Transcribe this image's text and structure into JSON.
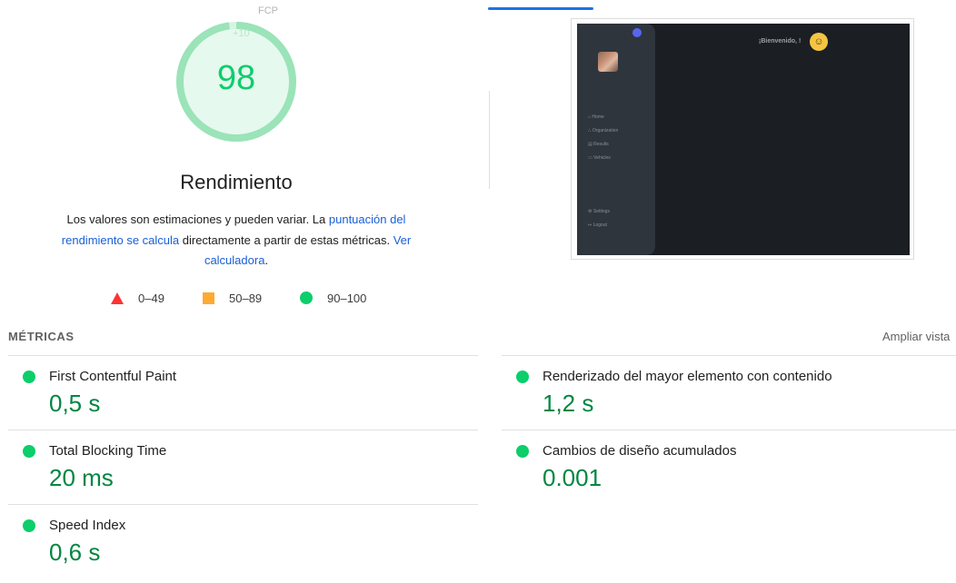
{
  "gauge": {
    "score": "98",
    "fraction": 0.98,
    "fcp_tag": "FCP",
    "fcp_value": "+10",
    "color": "#0cce6b"
  },
  "category_title": "Rendimiento",
  "description": {
    "text_1": "Los valores son estimaciones y pueden variar. La ",
    "link_1": "puntuación del rendimiento se calcula",
    "text_2": " directamente a partir de estas métricas. ",
    "link_2": "Ver calculadora",
    "text_3": "."
  },
  "legend": {
    "fail": "0–49",
    "average": "50–89",
    "pass": "90–100"
  },
  "screenshot": {
    "welcome": "¡Bienvenido, !",
    "emoji": "☺",
    "nav_items": [
      "Home",
      "Organization",
      "Results",
      "Vehicles"
    ],
    "bottom_items": [
      "Settings",
      "Logout"
    ]
  },
  "metrics": {
    "heading": "MÉTRICAS",
    "expand_label": "Ampliar vista",
    "items": [
      {
        "name": "First Contentful Paint",
        "value": "0,5 s"
      },
      {
        "name": "Renderizado del mayor elemento con contenido",
        "value": "1,2 s"
      },
      {
        "name": "Total Blocking Time",
        "value": "20 ms"
      },
      {
        "name": "Cambios de diseño acumulados",
        "value": "0.001"
      },
      {
        "name": "Speed Index",
        "value": "0,6 s"
      }
    ]
  },
  "colors": {
    "pass": "#0cce6b",
    "average": "#ffaa33",
    "fail": "#ff3333",
    "metric_value": "#018642",
    "link": "#1a5fd6"
  }
}
